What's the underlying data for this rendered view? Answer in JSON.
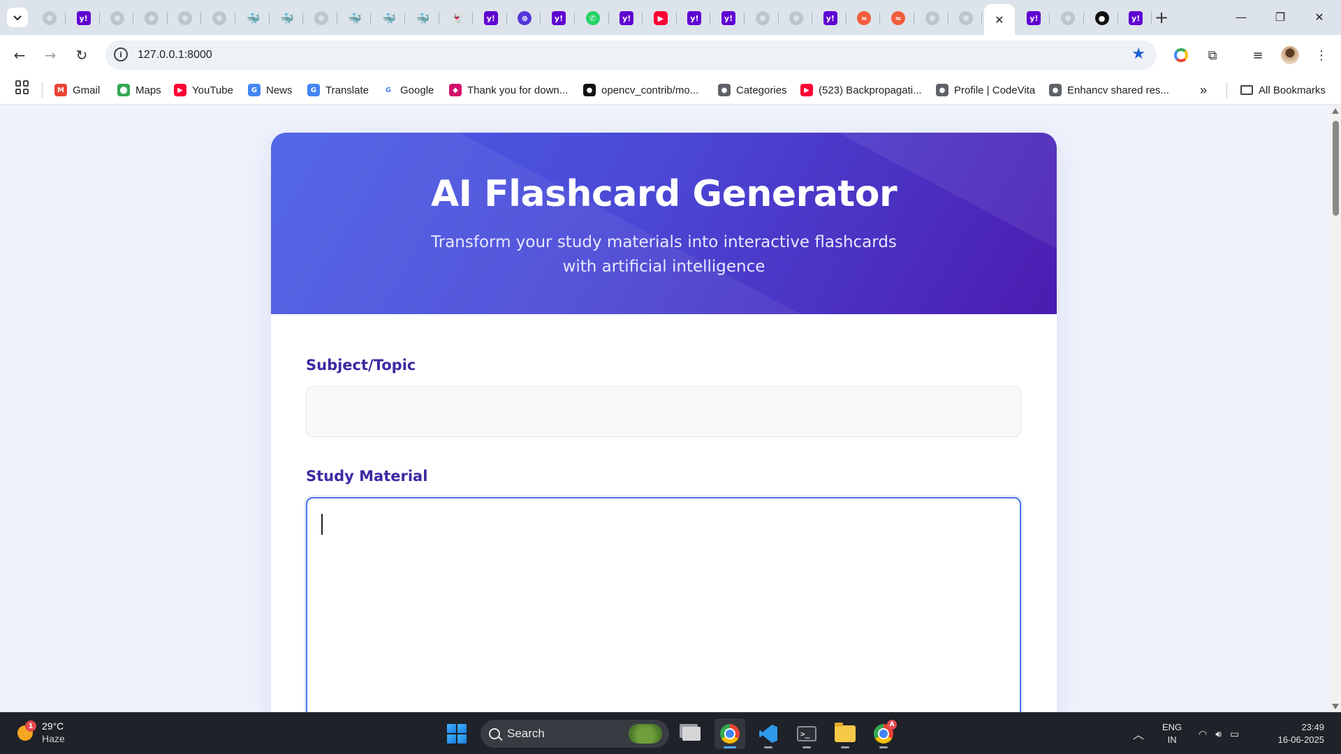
{
  "browser": {
    "tabs": [
      {
        "icon": "globe",
        "glyph": ""
      },
      {
        "icon": "yahoo",
        "glyph": "y!"
      },
      {
        "icon": "globe",
        "glyph": ""
      },
      {
        "icon": "globe",
        "glyph": ""
      },
      {
        "icon": "globe",
        "glyph": ""
      },
      {
        "icon": "globe",
        "glyph": ""
      },
      {
        "icon": "ds",
        "glyph": "🐳"
      },
      {
        "icon": "ds",
        "glyph": "🐳"
      },
      {
        "icon": "globe",
        "glyph": ""
      },
      {
        "icon": "ds",
        "glyph": "🐳"
      },
      {
        "icon": "ds",
        "glyph": "🐳"
      },
      {
        "icon": "dark",
        "glyph": "🐳"
      },
      {
        "icon": "ghost",
        "glyph": "👻"
      },
      {
        "icon": "yahoo",
        "glyph": "y!"
      },
      {
        "icon": "chatgpt",
        "glyph": "⊛"
      },
      {
        "icon": "yahoo",
        "glyph": "y!"
      },
      {
        "icon": "wa",
        "glyph": "✆"
      },
      {
        "icon": "yahoo",
        "glyph": "y!"
      },
      {
        "icon": "yt",
        "glyph": "▶"
      },
      {
        "icon": "yahoo",
        "glyph": "y!"
      },
      {
        "icon": "yahoo",
        "glyph": "y!"
      },
      {
        "icon": "globe",
        "glyph": ""
      },
      {
        "icon": "globe",
        "glyph": ""
      },
      {
        "icon": "yahoo",
        "glyph": "y!"
      },
      {
        "icon": "red",
        "glyph": "≈"
      },
      {
        "icon": "red",
        "glyph": "≈"
      },
      {
        "icon": "globe",
        "glyph": ""
      },
      {
        "icon": "globe",
        "glyph": ""
      },
      {
        "icon": "close",
        "glyph": "✕",
        "active": true
      },
      {
        "icon": "yahoo",
        "glyph": "y!"
      },
      {
        "icon": "globe",
        "glyph": ""
      },
      {
        "icon": "gh",
        "glyph": "●"
      },
      {
        "icon": "yahoo",
        "glyph": "y!"
      }
    ],
    "new_tab": "+",
    "url": "127.0.0.1:8000",
    "bookmarks": [
      {
        "label": "Gmail",
        "icon": "gmail-icon",
        "glyph": "M",
        "color": "#ea4335"
      },
      {
        "label": "Maps",
        "icon": "maps-icon",
        "glyph": "⬤",
        "color": "#34a853"
      },
      {
        "label": "YouTube",
        "icon": "youtube-icon",
        "glyph": "▶",
        "color": "#ff0033"
      },
      {
        "label": "News",
        "icon": "news-icon",
        "glyph": "G",
        "color": "#4285f4"
      },
      {
        "label": "Translate",
        "icon": "translate-icon",
        "glyph": "G",
        "color": "#4285f4"
      },
      {
        "label": "Google",
        "icon": "google-icon",
        "glyph": "G",
        "color": "#ffffff"
      },
      {
        "label": "Thank you for down...",
        "icon": "jetbrains-icon",
        "glyph": "◆",
        "color": "#d1106d"
      },
      {
        "label": "opencv_contrib/mo...",
        "icon": "github-icon",
        "glyph": "●",
        "color": "#111111"
      },
      {
        "label": "Categories",
        "icon": "globe-icon",
        "glyph": "●",
        "color": "#5f6368"
      },
      {
        "label": "(523) Backpropagati...",
        "icon": "youtube-icon",
        "glyph": "▶",
        "color": "#ff0033"
      },
      {
        "label": "Profile | CodeVita",
        "icon": "globe-icon",
        "glyph": "●",
        "color": "#5f6368"
      },
      {
        "label": "Enhancv shared res...",
        "icon": "globe-icon",
        "glyph": "●",
        "color": "#5f6368"
      }
    ],
    "more_bookmarks": "»",
    "all_bookmarks": "All Bookmarks"
  },
  "page": {
    "title": "AI Flashcard Generator",
    "subtitle": "Transform your study materials into interactive flashcards with artificial intelligence",
    "subject_label": "Subject/Topic",
    "subject_value": "",
    "material_label": "Study Material",
    "material_value": ""
  },
  "taskbar": {
    "weather_temp": "29°C",
    "weather_desc": "Haze",
    "weather_badge": "1",
    "search_label": "Search",
    "lang_top": "ENG",
    "lang_bottom": "IN",
    "time": "23:49",
    "date": "16-06-2025",
    "chrome_badge": "A"
  },
  "colors": {
    "accent": "#4a72e8",
    "hero_start": "#4a5fe6",
    "hero_end": "#4b1cb0",
    "label": "#3b2aa3"
  }
}
